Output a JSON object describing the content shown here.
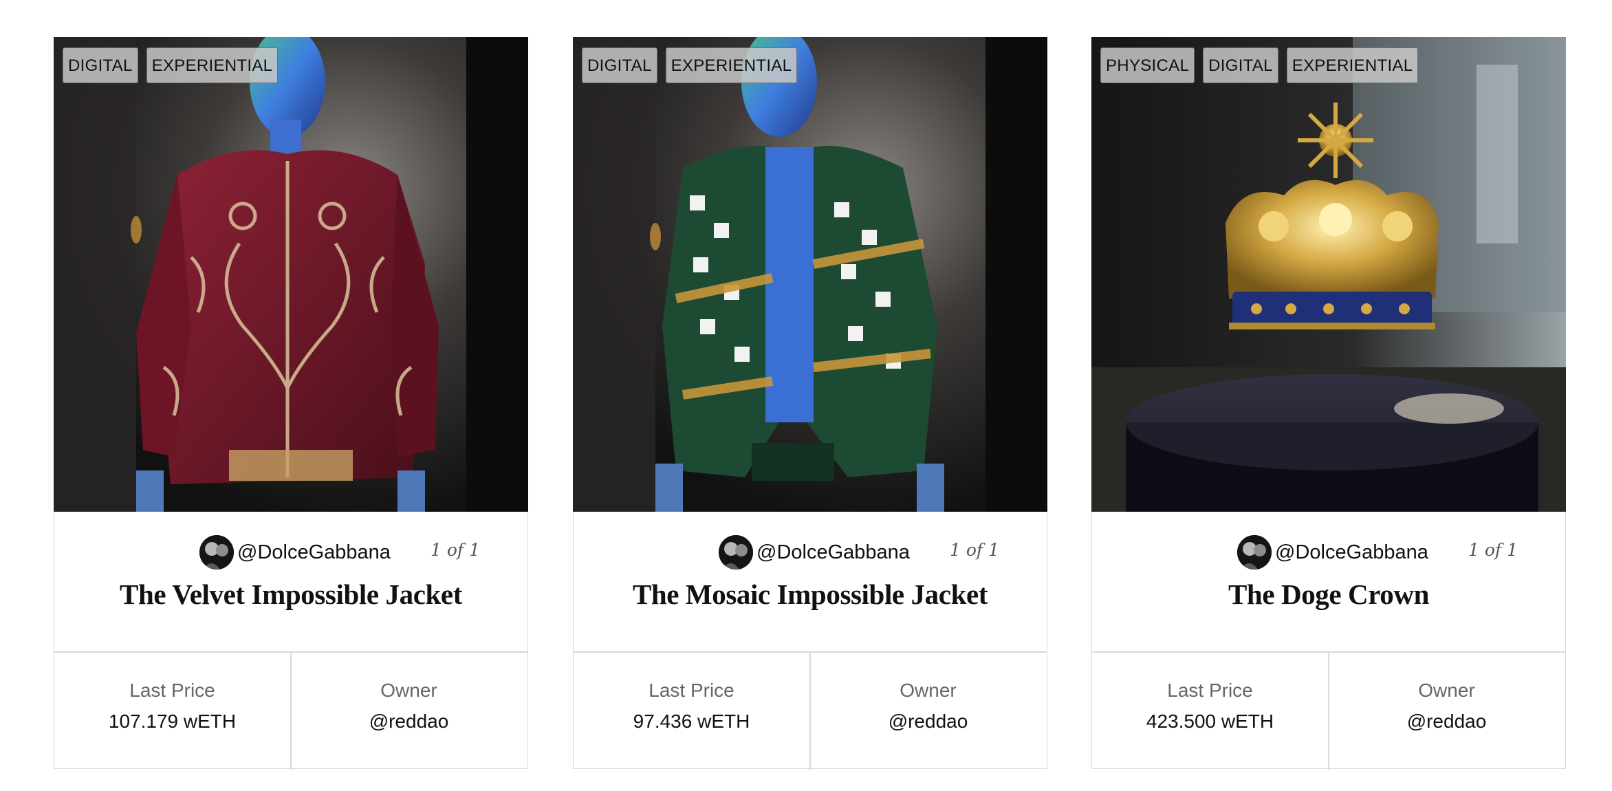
{
  "cards": [
    {
      "tags": [
        "DIGITAL",
        "EXPERIENTIAL"
      ],
      "creator": "@DolceGabbana",
      "edition": "1 of 1",
      "title": "The Velvet Impossible Jacket",
      "stats": {
        "last_price_label": "Last Price",
        "last_price": "107.179 wETH",
        "owner_label": "Owner",
        "owner": "@reddao"
      }
    },
    {
      "tags": [
        "DIGITAL",
        "EXPERIENTIAL"
      ],
      "creator": "@DolceGabbana",
      "edition": "1 of 1",
      "title": "The Mosaic Impossible Jacket",
      "stats": {
        "last_price_label": "Last Price",
        "last_price": "97.436 wETH",
        "owner_label": "Owner",
        "owner": "@reddao"
      }
    },
    {
      "tags": [
        "PHYSICAL",
        "DIGITAL",
        "EXPERIENTIAL"
      ],
      "creator": "@DolceGabbana",
      "edition": "1 of 1",
      "title": "The Doge Crown",
      "stats": {
        "last_price_label": "Last Price",
        "last_price": "423.500 wETH",
        "owner_label": "Owner",
        "owner": "@reddao"
      }
    }
  ],
  "colors": {
    "border": "#d9d9d9",
    "tag_bg": "#c8c8c8",
    "velvet_red": "#7a1a2e",
    "mannequin_blue": "#3a6fd8",
    "crown_gold": "#c9a24a"
  }
}
